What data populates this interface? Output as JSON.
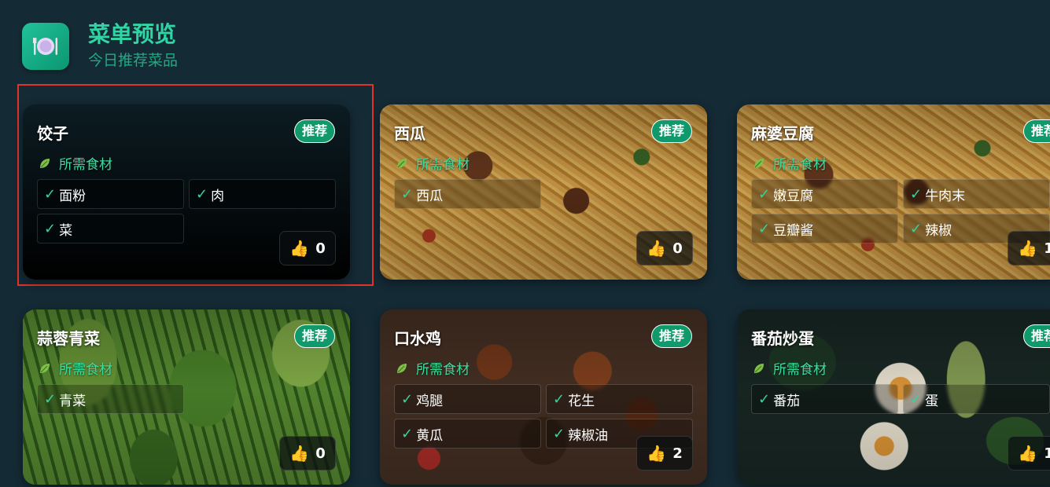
{
  "header": {
    "title": "菜单预览",
    "subtitle": "今日推荐菜品",
    "icon": "plate-cutlery-icon"
  },
  "labels": {
    "badge": "推荐",
    "ingredients": "所需食材",
    "check": "✓"
  },
  "colors": {
    "background": "#142a35",
    "accent": "#2fd6a3",
    "badge": "#109a6b",
    "selection": "#e0332b"
  },
  "cards": [
    {
      "name": "饺子",
      "ingredients": [
        "面粉",
        "肉",
        "菜"
      ],
      "likes": "0",
      "image": "none",
      "selected": true
    },
    {
      "name": "西瓜",
      "ingredients": [
        "西瓜"
      ],
      "likes": "0",
      "image": "pasta-photo"
    },
    {
      "name": "麻婆豆腐",
      "ingredients": [
        "嫩豆腐",
        "牛肉末",
        "豆瓣酱",
        "辣椒"
      ],
      "likes": "1",
      "image": "pasta-photo"
    },
    {
      "name": "蒜蓉青菜",
      "ingredients": [
        "青菜"
      ],
      "likes": "0",
      "image": "greens-photo"
    },
    {
      "name": "口水鸡",
      "ingredients": [
        "鸡腿",
        "花生",
        "黄瓜",
        "辣椒油"
      ],
      "likes": "2",
      "image": "grilled-meat-photo"
    },
    {
      "name": "番茄炒蛋",
      "ingredients": [
        "番茄",
        "蛋"
      ],
      "likes": "1",
      "image": "egg-salad-photo"
    }
  ]
}
